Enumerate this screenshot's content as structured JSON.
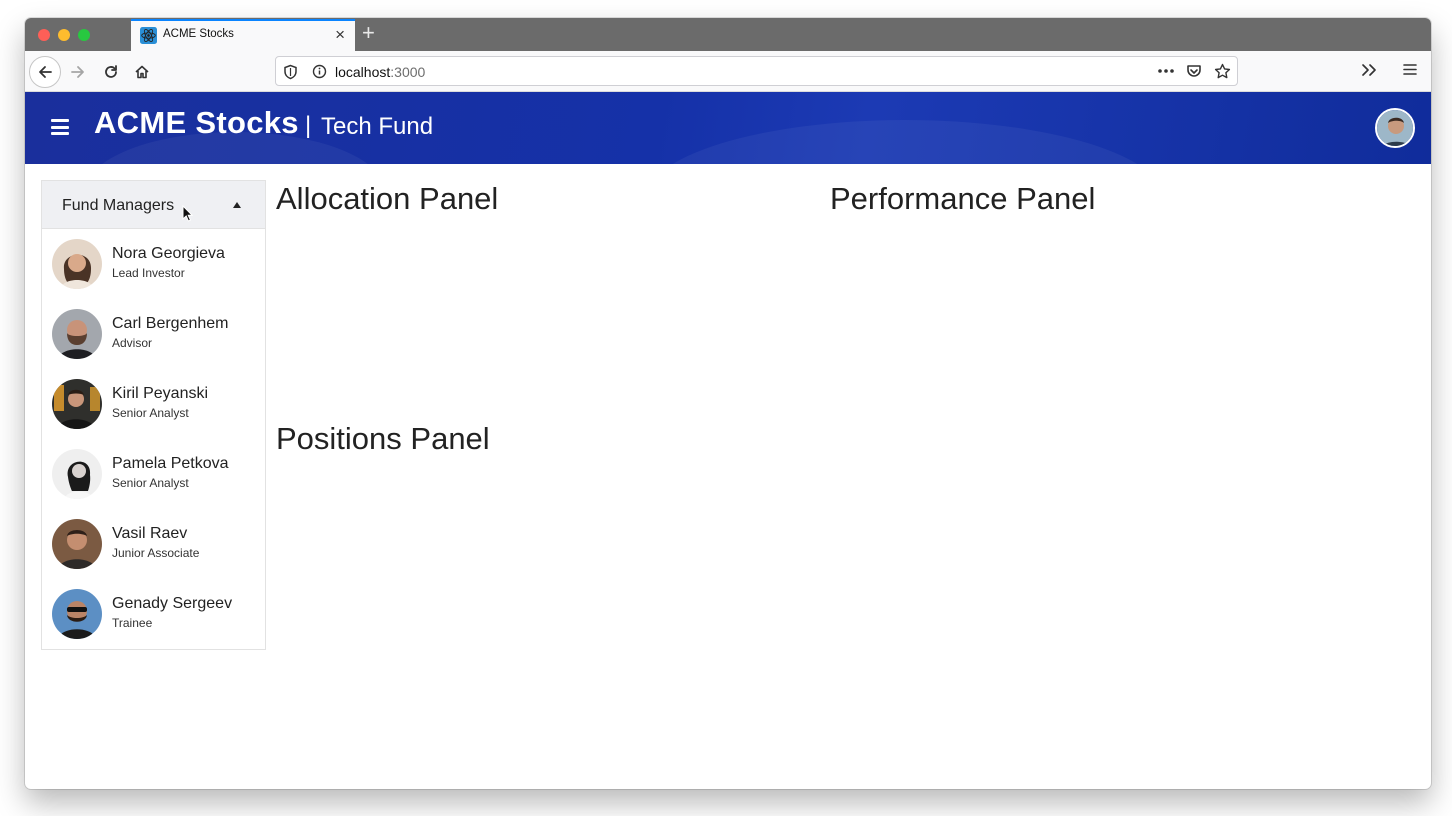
{
  "browser": {
    "tab_title": "ACME Stocks",
    "url_host": "localhost",
    "url_port": ":3000"
  },
  "header": {
    "brand": "ACME Stocks",
    "separator": "|",
    "subtitle": "Tech Fund"
  },
  "managers": {
    "title": "Fund Managers",
    "items": [
      {
        "name": "Nora Georgieva",
        "role": "Lead Investor"
      },
      {
        "name": "Carl Bergenhem",
        "role": "Advisor"
      },
      {
        "name": "Kiril Peyanski",
        "role": "Senior Analyst"
      },
      {
        "name": "Pamela Petkova",
        "role": "Senior Analyst"
      },
      {
        "name": "Vasil Raev",
        "role": "Junior Associate"
      },
      {
        "name": "Genady Sergeev",
        "role": "Trainee"
      }
    ]
  },
  "panels": {
    "allocation": "Allocation Panel",
    "performance": "Performance Panel",
    "positions": "Positions Panel"
  },
  "colors": {
    "header_bg": "#1531a8",
    "tab_accent": "#0a84ff"
  }
}
